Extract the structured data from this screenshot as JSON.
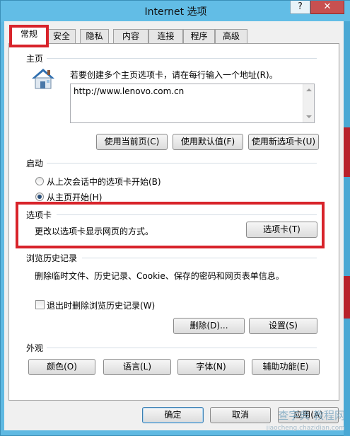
{
  "window": {
    "title": "Internet 选项",
    "help_label": "?",
    "close_label": "✕"
  },
  "tabs": [
    {
      "label": "常规"
    },
    {
      "label": "安全"
    },
    {
      "label": "隐私"
    },
    {
      "label": "内容"
    },
    {
      "label": "连接"
    },
    {
      "label": "程序"
    },
    {
      "label": "高级"
    }
  ],
  "home": {
    "title": "主页",
    "description": "若要创建多个主页选项卡，请在每行输入一个地址(R)。",
    "url_value": "http://www.lenovo.com.cn",
    "icon": "home-icon",
    "buttons": [
      "使用当前页(C)",
      "使用默认值(F)",
      "使用新选项卡(U)"
    ]
  },
  "startup": {
    "title": "启动",
    "options": [
      {
        "label": "从上次会话中的选项卡开始(B)",
        "selected": false
      },
      {
        "label": "从主页开始(H)",
        "selected": true
      }
    ]
  },
  "tabs_section": {
    "title": "选项卡",
    "description": "更改以选项卡显示网页的方式。",
    "button": "选项卡(T)"
  },
  "history": {
    "title": "浏览历史记录",
    "description": "删除临时文件、历史记录、Cookie、保存的密码和网页表单信息。",
    "checkbox_label": "退出时删除浏览历史记录(W)",
    "checkbox_checked": false,
    "delete_button": "删除(D)...",
    "settings_button": "设置(S)"
  },
  "appearance": {
    "title": "外观",
    "buttons": [
      "颜色(O)",
      "语言(L)",
      "字体(N)",
      "辅助功能(E)"
    ]
  },
  "footer": {
    "ok": "确定",
    "cancel": "取消",
    "apply": "应用(A)"
  },
  "watermark": {
    "line1": "查字典 教程网",
    "line2": "jiaocheng.chazidian.com"
  },
  "colors": {
    "highlight_box": "#d8232a",
    "title_bar": "#62bde6"
  }
}
